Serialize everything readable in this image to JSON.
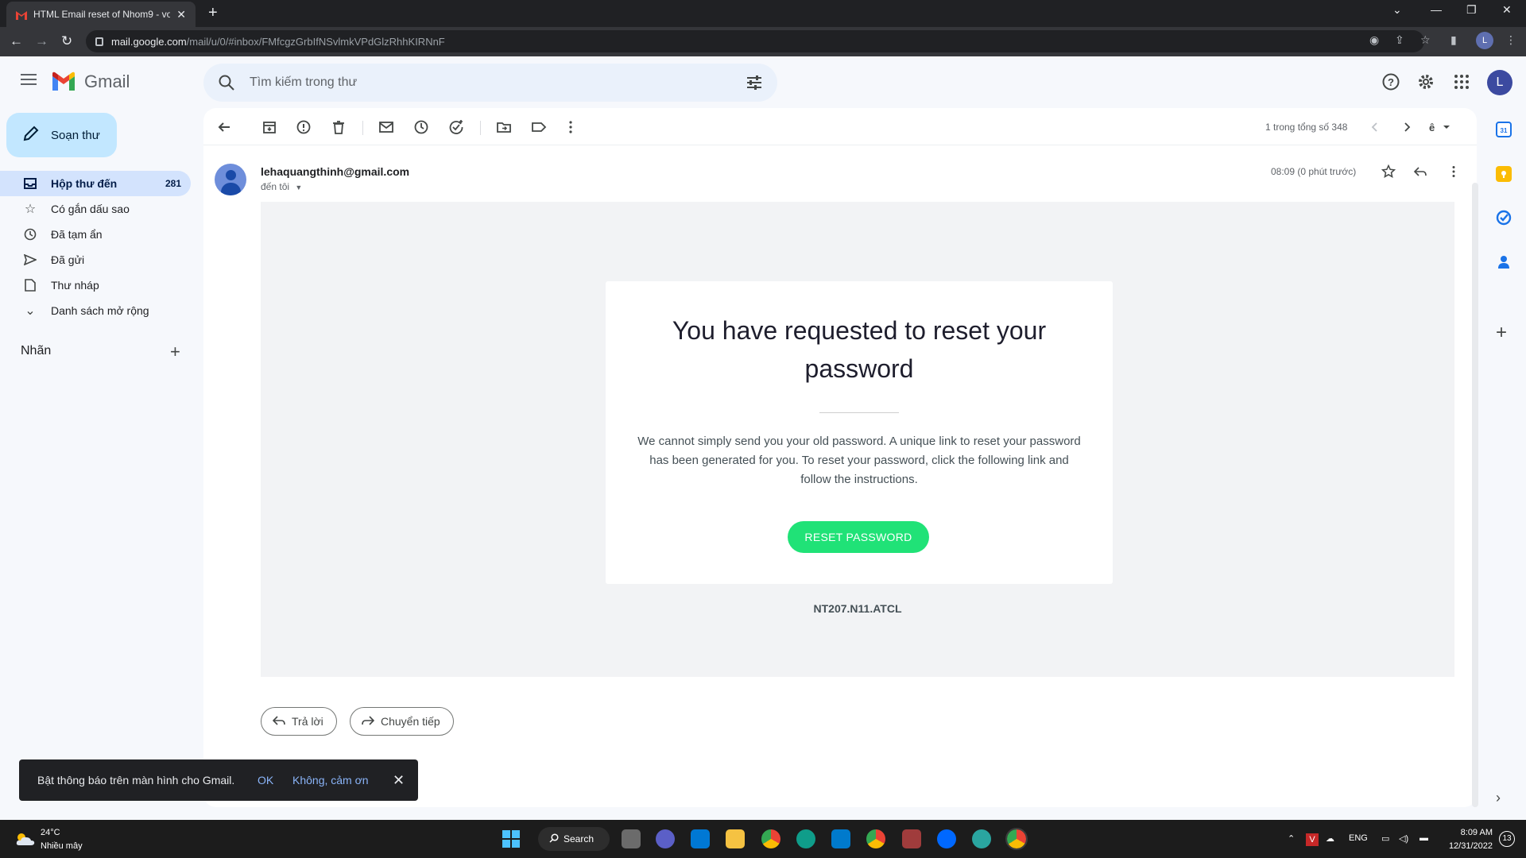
{
  "browser": {
    "tab_title": "HTML Email reset of Nhom9 - vo",
    "url_domain": "mail.google.com",
    "url_path": "/mail/u/0/#inbox/FMfcgzGrbIfNSvlmkVPdGlzRhhKIRNnF",
    "profile_initial": "L"
  },
  "gmail": {
    "app_name": "Gmail",
    "search_placeholder": "Tìm kiếm trong thư",
    "avatar_initial": "L"
  },
  "sidebar": {
    "compose_label": "Soạn thư",
    "items": [
      {
        "label": "Hộp thư đến",
        "count": "281",
        "icon": "inbox-icon"
      },
      {
        "label": "Có gắn dấu sao",
        "icon": "star-icon"
      },
      {
        "label": "Đã tạm ẩn",
        "icon": "clock-icon"
      },
      {
        "label": "Đã gửi",
        "icon": "send-icon"
      },
      {
        "label": "Thư nháp",
        "icon": "draft-icon"
      },
      {
        "label": "Danh sách mở rộng",
        "icon": "chevron-down-icon"
      }
    ],
    "labels_title": "Nhãn"
  },
  "toolbar": {
    "pager": "1 trong tổng số 348"
  },
  "message": {
    "sender": "lehaquangthinh@gmail.com",
    "to": "đến tôi",
    "time": "08:09 (0 phút trước)"
  },
  "email": {
    "heading": "You have requested to reset your password",
    "body": "We cannot simply send you your old password. A unique link to reset your password has been generated for you. To reset your password, click the following link and follow the instructions.",
    "button": "RESET PASSWORD",
    "footer": "NT207.N11.ATCL",
    "accent_color": "#20e277"
  },
  "actions": {
    "reply": "Trả lời",
    "forward": "Chuyển tiếp"
  },
  "snackbar": {
    "message": "Bật thông báo trên màn hình cho Gmail.",
    "ok": "OK",
    "dismiss": "Không, cảm ơn"
  },
  "taskbar": {
    "weather_temp": "24°C",
    "weather_desc": "Nhiều mây",
    "search_label": "Search",
    "language": "ENG",
    "time": "8:09 AM",
    "date": "12/31/2022",
    "notification_count": "13"
  }
}
